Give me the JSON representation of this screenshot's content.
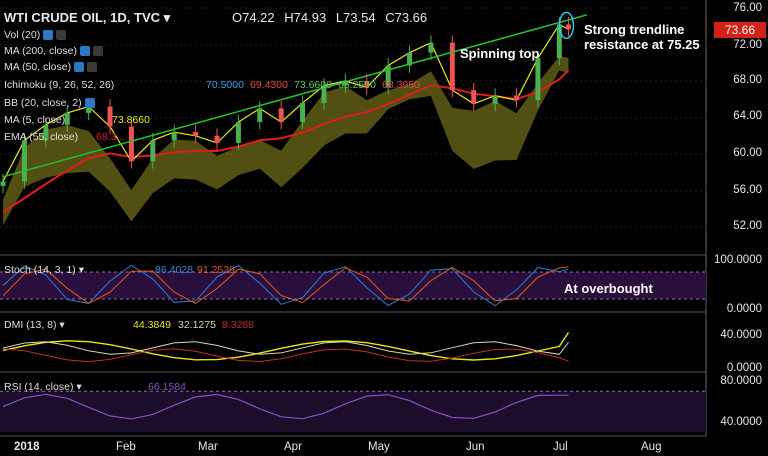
{
  "header": {
    "symbol": "WTI CRUDE OIL, 1D, TVC",
    "open": "O74.22",
    "high": "H74.93",
    "low": "L73.54",
    "close": "C73.66"
  },
  "indicators": {
    "vol": "Vol (20)",
    "ma200": "MA (200, close)",
    "ma50": "MA (50, close)",
    "ichimoku": "Ichimoku (9, 26, 52, 26)",
    "ichimoku_values": [
      "70.5000",
      "69.4300",
      "73.6600",
      "65.2550",
      "68.3950"
    ],
    "bb": "BB (20, close, 2)",
    "ma5": "MA (5, close)",
    "ma5_value": "73.8660",
    "ema55": "EMA (55, close)",
    "ema55_value": "68.3..."
  },
  "annotations": {
    "trendline_label_1": "Strong trendline",
    "trendline_label_2": "resistance at 75.25",
    "spinning_top": "Spinning top",
    "overbought": "At overbought"
  },
  "price_axis": {
    "ticks": [
      "76.00",
      "72.00",
      "68.00",
      "64.00",
      "60.00",
      "56.00",
      "52.00"
    ],
    "last_price": "73.66"
  },
  "time_axis": {
    "labels": [
      "2018",
      "Feb",
      "Mar",
      "Apr",
      "May",
      "Jun",
      "Jul",
      "Aug"
    ]
  },
  "stoch": {
    "label": "Stoch (14, 3, 1)",
    "k": "86.4028",
    "d": "91.2529",
    "ticks": [
      "100.0000",
      "0.0000"
    ]
  },
  "dmi": {
    "label": "DMI (13, 8)",
    "adx": "44.3849",
    "plus": "32.1275",
    "minus": "8.3288",
    "ticks": [
      "40.0000",
      "0.0000"
    ]
  },
  "rsi": {
    "label": "RSI (14, close)",
    "value": "66.1584",
    "ticks": [
      "80.0000",
      "40.0000"
    ]
  },
  "colors": {
    "background": "#000000",
    "candle_up": "#4caf50",
    "candle_down": "#ef5350",
    "trendline": "#22c22e",
    "ema55": "#e11d1d",
    "ma5": "#e8e810",
    "ichimoku_cloud": "#6e6a18",
    "stoch_k": "#2e7cd6",
    "stoch_d": "#e25a18",
    "stoch_band": "#2a0f3d",
    "rsi": "#8a4fc8",
    "dmi_adx": "#e8e810",
    "dmi_plus": "#d8d8b0",
    "dmi_minus": "#c0302a",
    "price_tag": "#d4221a"
  },
  "chart_data": {
    "type": "line",
    "title": "WTI CRUDE OIL, 1D, TVC",
    "x_range": [
      "2018-01-01",
      "2018-08-20"
    ],
    "ylim": [
      50,
      77
    ],
    "close_series": [
      {
        "date": "2018-01-02",
        "close": 57.0
      },
      {
        "date": "2018-01-09",
        "close": 61.5
      },
      {
        "date": "2018-01-16",
        "close": 63.2
      },
      {
        "date": "2018-01-23",
        "close": 64.5
      },
      {
        "date": "2018-01-30",
        "close": 65.2
      },
      {
        "date": "2018-02-06",
        "close": 63.0
      },
      {
        "date": "2018-02-13",
        "close": 59.2
      },
      {
        "date": "2018-02-20",
        "close": 61.5
      },
      {
        "date": "2018-02-27",
        "close": 62.4
      },
      {
        "date": "2018-03-06",
        "close": 62.0
      },
      {
        "date": "2018-03-13",
        "close": 61.2
      },
      {
        "date": "2018-03-20",
        "close": 63.5
      },
      {
        "date": "2018-03-27",
        "close": 65.0
      },
      {
        "date": "2018-04-03",
        "close": 63.5
      },
      {
        "date": "2018-04-10",
        "close": 65.6
      },
      {
        "date": "2018-04-17",
        "close": 67.5
      },
      {
        "date": "2018-04-24",
        "close": 68.0
      },
      {
        "date": "2018-05-01",
        "close": 67.3
      },
      {
        "date": "2018-05-08",
        "close": 69.7
      },
      {
        "date": "2018-05-15",
        "close": 71.1
      },
      {
        "date": "2018-05-22",
        "close": 72.2
      },
      {
        "date": "2018-05-29",
        "close": 67.0
      },
      {
        "date": "2018-06-05",
        "close": 65.5
      },
      {
        "date": "2018-06-12",
        "close": 66.4
      },
      {
        "date": "2018-06-19",
        "close": 65.9
      },
      {
        "date": "2018-06-26",
        "close": 70.5
      },
      {
        "date": "2018-07-03",
        "close": 74.2
      },
      {
        "date": "2018-07-06",
        "close": 73.66
      }
    ],
    "trendline": {
      "from": {
        "date": "2018-01-02",
        "value": 57.5
      },
      "to": {
        "date": "2018-07-12",
        "value": 75.25
      }
    },
    "stoch": {
      "k": 86.4028,
      "d": 91.2529
    },
    "dmi": {
      "adx": 44.3849,
      "plus_di": 32.1275,
      "minus_di": 8.3288
    },
    "rsi": 66.1584
  }
}
